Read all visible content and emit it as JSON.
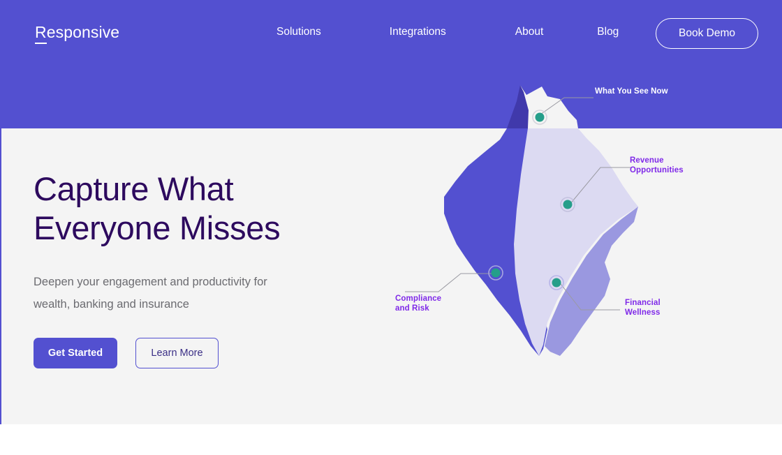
{
  "brand": {
    "logo_text": "Responsive",
    "logo_first_letter": "R",
    "logo_rest": "esponsive",
    "header_color": "#5350d0",
    "accent_color": "#5350d0",
    "headline_color": "#2d0a5e",
    "label_violet": "#7f29e8",
    "dot_color": "#259e8a",
    "hero_bg": "#f4f4f4"
  },
  "nav": {
    "items": [
      {
        "label": "Solutions"
      },
      {
        "label": "Integrations"
      },
      {
        "label": "About"
      },
      {
        "label": "Blog"
      }
    ],
    "cta_label": "Book Demo"
  },
  "hero": {
    "headline_line1": "Capture What",
    "headline_line2": "Everyone Misses",
    "subhead_line1": "Deepen your engagement and productivity for",
    "subhead_line2": "wealth, banking and insurance",
    "primary_button": "Get Started",
    "secondary_button": "Learn More"
  },
  "graphic": {
    "name": "iceberg-diagram",
    "callouts": [
      {
        "id": "see-now",
        "text": "What You See Now",
        "color": "#ffffff"
      },
      {
        "id": "revenue",
        "text": "Revenue\nOpportunities",
        "color": "#7f29e8"
      },
      {
        "id": "compliance",
        "text": "Compliance\nand Risk",
        "color": "#7f29e8"
      },
      {
        "id": "financial",
        "text": "Financial\nWellness",
        "color": "#7f29e8"
      }
    ],
    "region_colors": {
      "tip": "#f4f4f4",
      "tip_shadow": "#4039ab",
      "left": "#5350d0",
      "center": "#dcdaf2",
      "right": "#9a98e0"
    }
  }
}
